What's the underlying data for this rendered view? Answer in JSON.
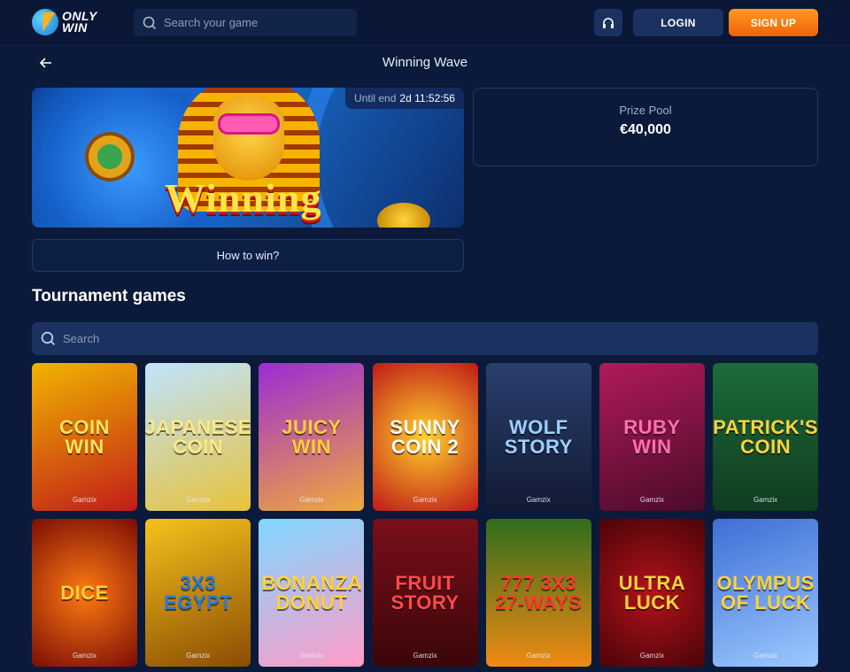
{
  "header": {
    "logo_line1": "ONLY",
    "logo_line2": "WIN",
    "search_placeholder": "Search your game",
    "login_label": "LOGIN",
    "signup_label": "SIGN UP"
  },
  "page": {
    "title": "Winning Wave"
  },
  "banner": {
    "title": "Winning",
    "until_label": "Until end",
    "until_value": "2d 11:52:56"
  },
  "prize": {
    "label": "Prize Pool",
    "value": "€40,000"
  },
  "how_to_win_label": "How to win?",
  "games_section": {
    "title": "Tournament games",
    "search_placeholder": "Search"
  },
  "games": [
    {
      "name": "COIN WIN",
      "provider": "Gamzix",
      "bg": "linear-gradient(160deg,#f0b400,#c21d18)",
      "color": "#ffe45c"
    },
    {
      "name": "JAPANESE COIN",
      "provider": "Gamzix",
      "bg": "linear-gradient(160deg,#bfe4ff,#e7c23a)",
      "color": "#ffe98a"
    },
    {
      "name": "JUICY WIN",
      "provider": "Gamzix",
      "bg": "linear-gradient(160deg,#9c2bd6,#f0a93a)",
      "color": "#ffcf3d"
    },
    {
      "name": "SUNNY COIN 2",
      "provider": "Gamzix",
      "bg": "radial-gradient(circle,#ffd22a,#c01818)",
      "color": "#ffffff"
    },
    {
      "name": "WOLF STORY",
      "provider": "Gamzix",
      "bg": "linear-gradient(180deg,#2a3f6d,#121a33)",
      "color": "#9ed0ff"
    },
    {
      "name": "RUBY WIN",
      "provider": "Gamzix",
      "bg": "linear-gradient(160deg,#b01a5a,#4a0b2a)",
      "color": "#ff6fb0"
    },
    {
      "name": "PATRICK'S COIN",
      "provider": "Gamzix",
      "bg": "linear-gradient(180deg,#1d6b3a,#0f3c1f)",
      "color": "#ffd43a"
    },
    {
      "name": "DICE",
      "provider": "Gamzix",
      "bg": "radial-gradient(circle,#ff7a12,#7a0d05)",
      "color": "#ffd23a"
    },
    {
      "name": "3x3 EGYPT",
      "provider": "Gamzix",
      "bg": "linear-gradient(160deg,#f5c21c,#8b4c03)",
      "color": "#2a7bd8"
    },
    {
      "name": "BONANZA DONUT",
      "provider": "Gamzix",
      "bg": "linear-gradient(160deg,#7fd7ff,#ff9cc8)",
      "color": "#ffd23a"
    },
    {
      "name": "FRUIT STORY",
      "provider": "Gamzix",
      "bg": "linear-gradient(180deg,#7a0f1a,#3a0609)",
      "color": "#ff4a4a"
    },
    {
      "name": "777 3x3 27-WAYS",
      "provider": "Gamzix",
      "bg": "linear-gradient(180deg,#2f6d1c,#f08a12)",
      "color": "#ff3a2a"
    },
    {
      "name": "ULTRA LUCK",
      "provider": "Gamzix",
      "bg": "radial-gradient(circle,#b3121c,#4a0408)",
      "color": "#ffd23a"
    },
    {
      "name": "OLYMPUS OF LUCK",
      "provider": "Gamzix",
      "bg": "linear-gradient(160deg,#3e6fd6,#9cc8ff)",
      "color": "#ffd23a"
    }
  ]
}
